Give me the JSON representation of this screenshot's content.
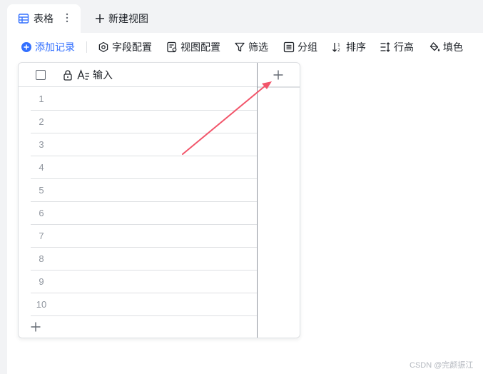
{
  "tabs": {
    "active_label": "表格",
    "new_view_label": "新建视图"
  },
  "toolbar": {
    "add_record": "添加记录",
    "field_config": "字段配置",
    "view_config": "视图配置",
    "filter": "筛选",
    "group": "分组",
    "sort": "排序",
    "row_height": "行高",
    "fill_color": "填色"
  },
  "grid": {
    "column_name": "输入",
    "row_numbers": [
      "1",
      "2",
      "3",
      "4",
      "5",
      "6",
      "7",
      "8",
      "9",
      "10"
    ]
  },
  "colors": {
    "accent": "#3370ff",
    "arrow": "#f2556a"
  },
  "watermark": "CSDN @完颜振江"
}
